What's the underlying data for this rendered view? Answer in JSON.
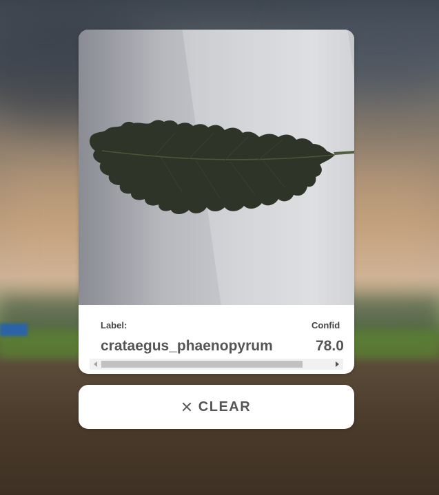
{
  "result": {
    "label_title": "Label:",
    "label_value": "crataegus_phaenopyrum",
    "confidence_title": "Confid",
    "confidence_value": "78.0"
  },
  "clear_button": {
    "label": "CLEAR",
    "icon": "close-icon"
  },
  "photo": {
    "subject": "leaf-image"
  }
}
